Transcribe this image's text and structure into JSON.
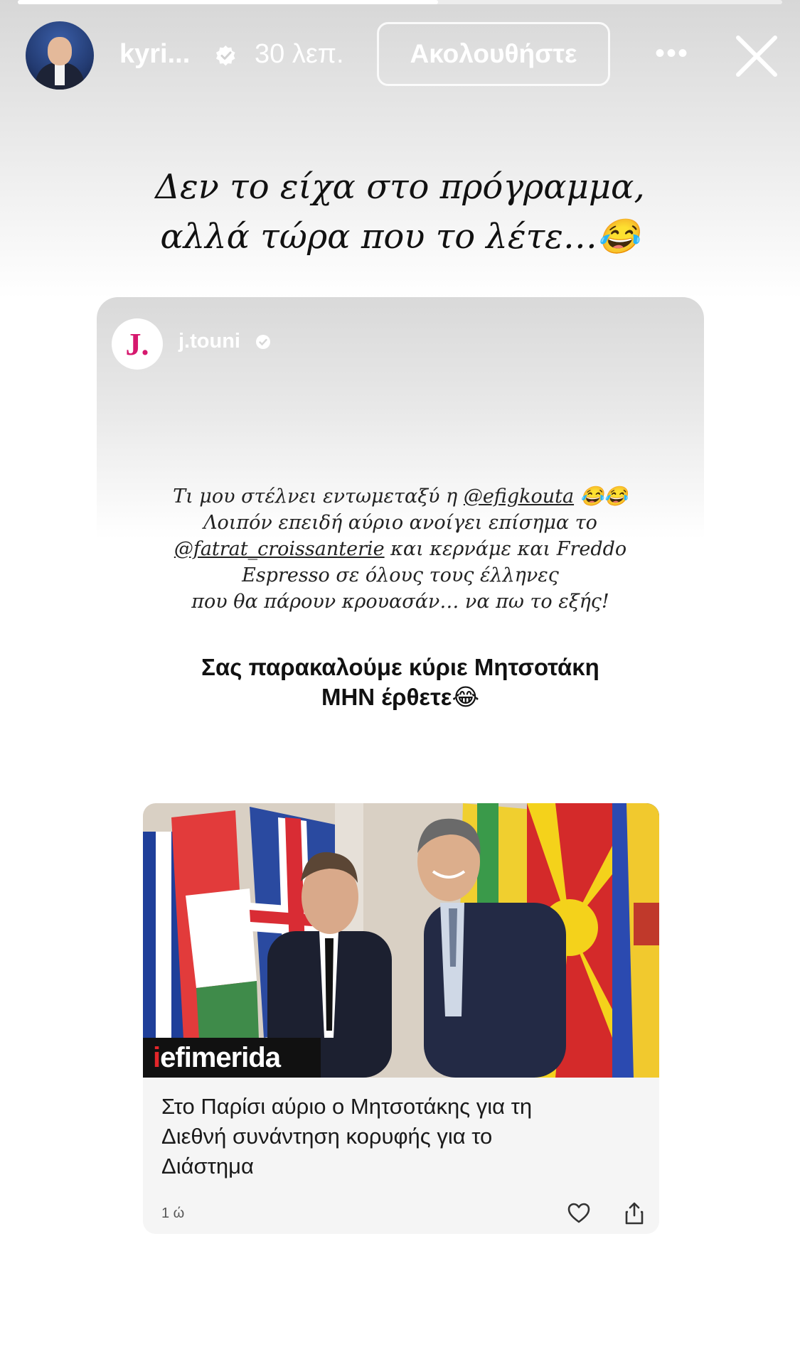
{
  "story": {
    "progress": 0.55,
    "username": "kyri...",
    "time": "30 λεπ.",
    "follow_label": "Ακολουθήστε",
    "more_label": "•••",
    "caption_lines": [
      "Δεν το είχα στο πρόγραμμα,",
      "αλλά τώρα που το λέτε…😂"
    ]
  },
  "shared_post": {
    "avatar_letter": "J.",
    "username": "j.touni",
    "text_lines": [
      {
        "before": "Τι μου στέλνει εντωμεταξύ η ",
        "mention": "@efigkouta",
        "after": " 😂😂"
      },
      {
        "before": "Λοιπόν επειδή αύριο ανοίγει επίσημα το",
        "mention": "",
        "after": ""
      },
      {
        "before": "",
        "mention": "@fatrat_croissanterie",
        "after": " και κερνάμε και Freddo"
      },
      {
        "before": "Espresso σε όλους τους έλληνες",
        "mention": "",
        "after": ""
      },
      {
        "before": "που θα πάρουν κρουασάν… να πω το εξής!",
        "mention": "",
        "after": ""
      }
    ],
    "plea_lines": [
      "Σας παρακαλούμε κύριε Μητσοτάκη",
      "ΜΗΝ έρθετε😂"
    ]
  },
  "article": {
    "brand_prefix": "i",
    "brand_rest": "efimerida",
    "title_lines": [
      "Στο Παρίσι αύριο ο Μητσοτάκης για τη",
      "Διεθνή συνάντηση κορυφής για το",
      "Διάστημα"
    ],
    "age": "1 ώ"
  }
}
